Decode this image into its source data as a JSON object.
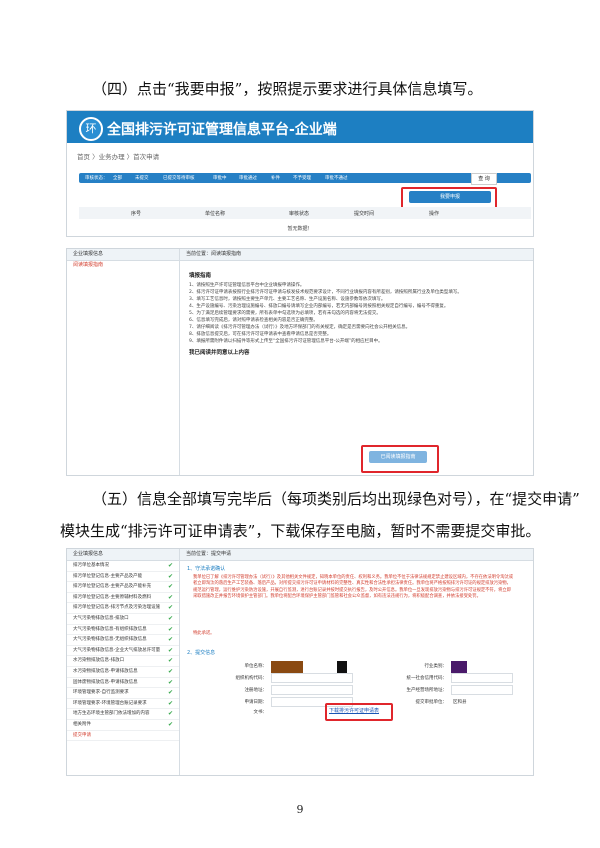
{
  "paragraphs": {
    "p4": "（四）点击“我要申报”，按照提示要求进行具体信息填写。",
    "p5_line1": "（五）信息全部填写完毕后（每项类别后均出现绿色对号），在“提交申请”",
    "p5_line2": "模块生成“排污许可证申请表”，下载保存至电脑，暂时不需要提交审批。"
  },
  "screenshot1": {
    "logo_glyph": "环",
    "title": "全国排污许可证管理信息平台-企业端",
    "breadcrumb": "首页 〉业务办理 〉首次申请",
    "filter_label": "审核状态：",
    "filters": [
      "全部",
      "未提交",
      "已提交等待审核",
      "审批中",
      "审批通过",
      "补件",
      "不予受理",
      "审批不通过"
    ],
    "query_label": "查 询",
    "report_label": "我要申报",
    "columns": [
      "序号",
      "单位名称",
      "审核状态",
      "提交时间",
      "操作"
    ],
    "empty_text": "暂无数据！"
  },
  "screenshot2": {
    "left_header": "企业填报信息",
    "left_item": "阅读填报指南",
    "location": "当前位置：阅读填报指南",
    "heading": "填报指南",
    "items": [
      "1、请按照生产许可证管理信息平台中企业填报申请操作。",
      "2、排污许可证申请表按照行业排污许可证申请与核发技术规范要求设计，不同行业填报内容有所差别，请按照所属行业及单位类型填写。",
      "3、填写工艺信息时，请按照主要生产单元、主要工艺名称、生产设施名称、设施参数等依次填写。",
      "4、生产设施编号、污染治理设施编号、排放口编号请填写企业内部编号，若无内部编号则按照相关规定自行编号，编号不得重复。",
      "5、为了满足后续管理要求的需要，所有表单中勾选项为必填项，若有未勾选的内容将无法提交。",
      "6、信息填写完成后，请对照申请表检查相关内容是否正确完整。",
      "7、请仔细阅读《排污许可管理办法（试行）》及地方环保部门的有关规定，确定是否需要向社会公开相关信息。",
      "8、排放信息提交后，可在排污许可证申请表中查看申请信息是否完整。",
      "9、填报所需附件请以扫描件等形式上传至“全国排污许可证管理信息平台-公开端”的相应栏目中。"
    ],
    "agree_text": "我已阅读并同意以上内容",
    "button_label": "已阅读填报指南"
  },
  "screenshot3": {
    "left_header": "企业填报信息",
    "left_items": [
      {
        "label": "排污单位基本情况",
        "done": true
      },
      {
        "label": "排污单位登记信息-主要产品及产能",
        "done": true
      },
      {
        "label": "排污单位登记信息-主要产品及产能补充",
        "done": true
      },
      {
        "label": "排污单位登记信息-主要原辅材料及燃料",
        "done": true
      },
      {
        "label": "排污单位登记信息-排污节点及污染治理设施",
        "done": true
      },
      {
        "label": "大气污染物排放信息-排放口",
        "done": true
      },
      {
        "label": "大气污染物排放信息-有组织排放信息",
        "done": true
      },
      {
        "label": "大气污染物排放信息-无组织排放信息",
        "done": true
      },
      {
        "label": "大气污染物排放信息-企业大气排放总许可量",
        "done": true
      },
      {
        "label": "水污染物排放信息-排放口",
        "done": true
      },
      {
        "label": "水污染物排放信息-申请排放信息",
        "done": true
      },
      {
        "label": "固体废物排放信息-申请排放信息",
        "done": true
      },
      {
        "label": "环境管理要求-自行监测要求",
        "done": true
      },
      {
        "label": "环境管理要求-环境管理台账记录要求",
        "done": true
      },
      {
        "label": "地方生态环境主管部门依法增加的内容",
        "done": true
      },
      {
        "label": "相关附件",
        "done": true
      },
      {
        "label": "提交申请",
        "done": false,
        "active": true
      }
    ],
    "location": "当前位置：提交申请",
    "section1": "1、守法承诺确认",
    "commitment": "我单位已了解《排污许可管理办法（试行）》及其他相关文件规定，知晓本单位的责任、权利和义务。我单位不位于法律法规规定禁止建设区域内，不存在依法明令淘汰或者立即淘汰的落后生产工艺装备、落后产品，对所提交排污许可证申请材料的完整性、真实性和合法性承担法律责任。我单位将严格按照排污许可证的规定排放污染物，规范运行管理，运行维护污染防治设施，开展自行监测，进行台账记录并按时提交执行报告，及时公开信息。我单位一旦发现排放污染物与排污许可证规定不符，将立即采取措施改正并报告环境保护主管部门。我单位将配合环境保护主管部门监管和社会公众监督，如有违法违规行为，将积极配合调查，并依法接受处罚。",
    "commitment_end": "特此承诺。",
    "section2": "2、提交信息",
    "labels": {
      "unit_name": "单位名称：",
      "org_code": "组织机构代码：",
      "address": "注册地址：",
      "apply_date": "申请日期：",
      "document": "文书：",
      "industry": "行业类别：",
      "credit_code": "统一社会信用代码：",
      "prod_address": "生产经营场所地址：",
      "submit_unit": "提交审批单位：",
      "submit_unit_value": "区和县"
    },
    "download_link": "下载排污许可证申请表",
    "colors": {
      "check": "#36a84c",
      "redact_brown": "#8a4a12",
      "redact_purple": "#4a1a6a"
    }
  },
  "page_number": "9",
  "colors": {
    "header_blue": "#1d7fc2",
    "highlight_red": "#e0262c"
  }
}
